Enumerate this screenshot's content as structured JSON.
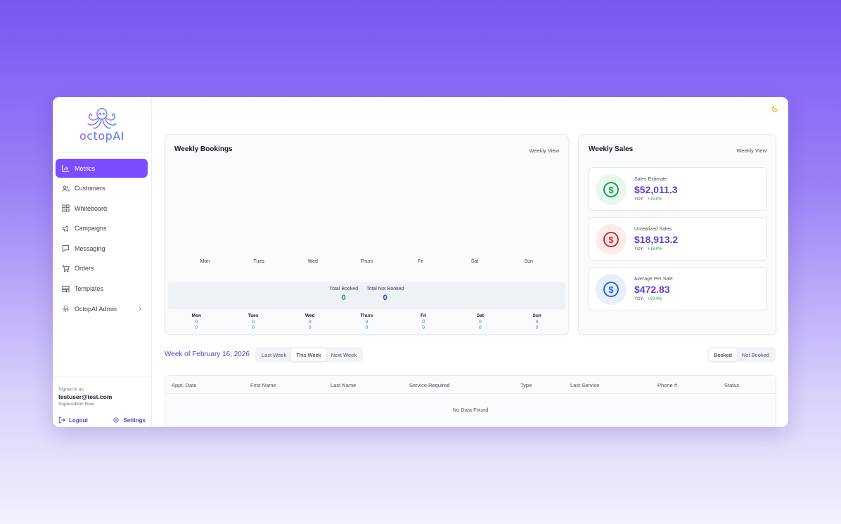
{
  "brand": {
    "logo_text": "octopAI"
  },
  "sidebar": {
    "items": [
      {
        "label": "Metrics",
        "icon": "bar-chart-icon",
        "active": true
      },
      {
        "label": "Customers",
        "icon": "users-icon"
      },
      {
        "label": "Whiteboard",
        "icon": "grid-icon"
      },
      {
        "label": "Campaigns",
        "icon": "megaphone-icon"
      },
      {
        "label": "Messaging",
        "icon": "message-icon"
      },
      {
        "label": "Orders",
        "icon": "cart-icon"
      },
      {
        "label": "Templates",
        "icon": "layout-icon"
      },
      {
        "label": "OctopAI Admin",
        "icon": "octopus-icon"
      }
    ],
    "footer": {
      "signed_in_label": "Signed in as:",
      "email": "testuser@test.com",
      "role": "SuperAdmin Role",
      "logout_label": "Logout",
      "settings_label": "Settings"
    }
  },
  "bookings": {
    "title": "Weekly Bookings",
    "view_label": "Weekly View",
    "days": [
      "Mon",
      "Tues",
      "Wed",
      "Thurs",
      "Fri",
      "Sat",
      "Sun"
    ],
    "total_booked_label": "Total Booked",
    "total_booked": "0",
    "total_not_booked_label": "Total Not Booked",
    "total_not_booked": "0",
    "daily": [
      {
        "day": "Mon",
        "booked": "0",
        "not_booked": "0"
      },
      {
        "day": "Tues",
        "booked": "0",
        "not_booked": "0"
      },
      {
        "day": "Wed",
        "booked": "0",
        "not_booked": "0"
      },
      {
        "day": "Thurs",
        "booked": "0",
        "not_booked": "0"
      },
      {
        "day": "Fri",
        "booked": "0",
        "not_booked": "0"
      },
      {
        "day": "Sat",
        "booked": "0",
        "not_booked": "0"
      },
      {
        "day": "Sun",
        "booked": "0",
        "not_booked": "0"
      }
    ]
  },
  "sales": {
    "title": "Weekly Sales",
    "view_label": "Weekly View",
    "yoy_label": "YOY:",
    "items": [
      {
        "label": "Sales Estimate",
        "value": "$52,011.3",
        "yoy": "+19.0%",
        "color": "#16a34a",
        "bg": "#e9f8ee"
      },
      {
        "label": "Unrealized Sales",
        "value": "$18,913.2",
        "yoy": "+16.0%",
        "color": "#dc2626",
        "bg": "#fdecec"
      },
      {
        "label": "Average Per Sale",
        "value": "$472.83",
        "yoy": "+20.4%",
        "color": "#2563eb",
        "bg": "#e8effc"
      }
    ]
  },
  "week": {
    "title": "Week of February 16, 2026",
    "nav": {
      "last": "Last Week",
      "this": "This Week",
      "next": "Next Week"
    },
    "filter": {
      "booked": "Booked",
      "not_booked": "Not Booked"
    }
  },
  "table": {
    "columns": [
      "Appt. Date",
      "First Name",
      "Last Name",
      "Service Required",
      "Type",
      "Last Service",
      "Phone #",
      "Status"
    ],
    "empty_text": "No Data Found"
  }
}
